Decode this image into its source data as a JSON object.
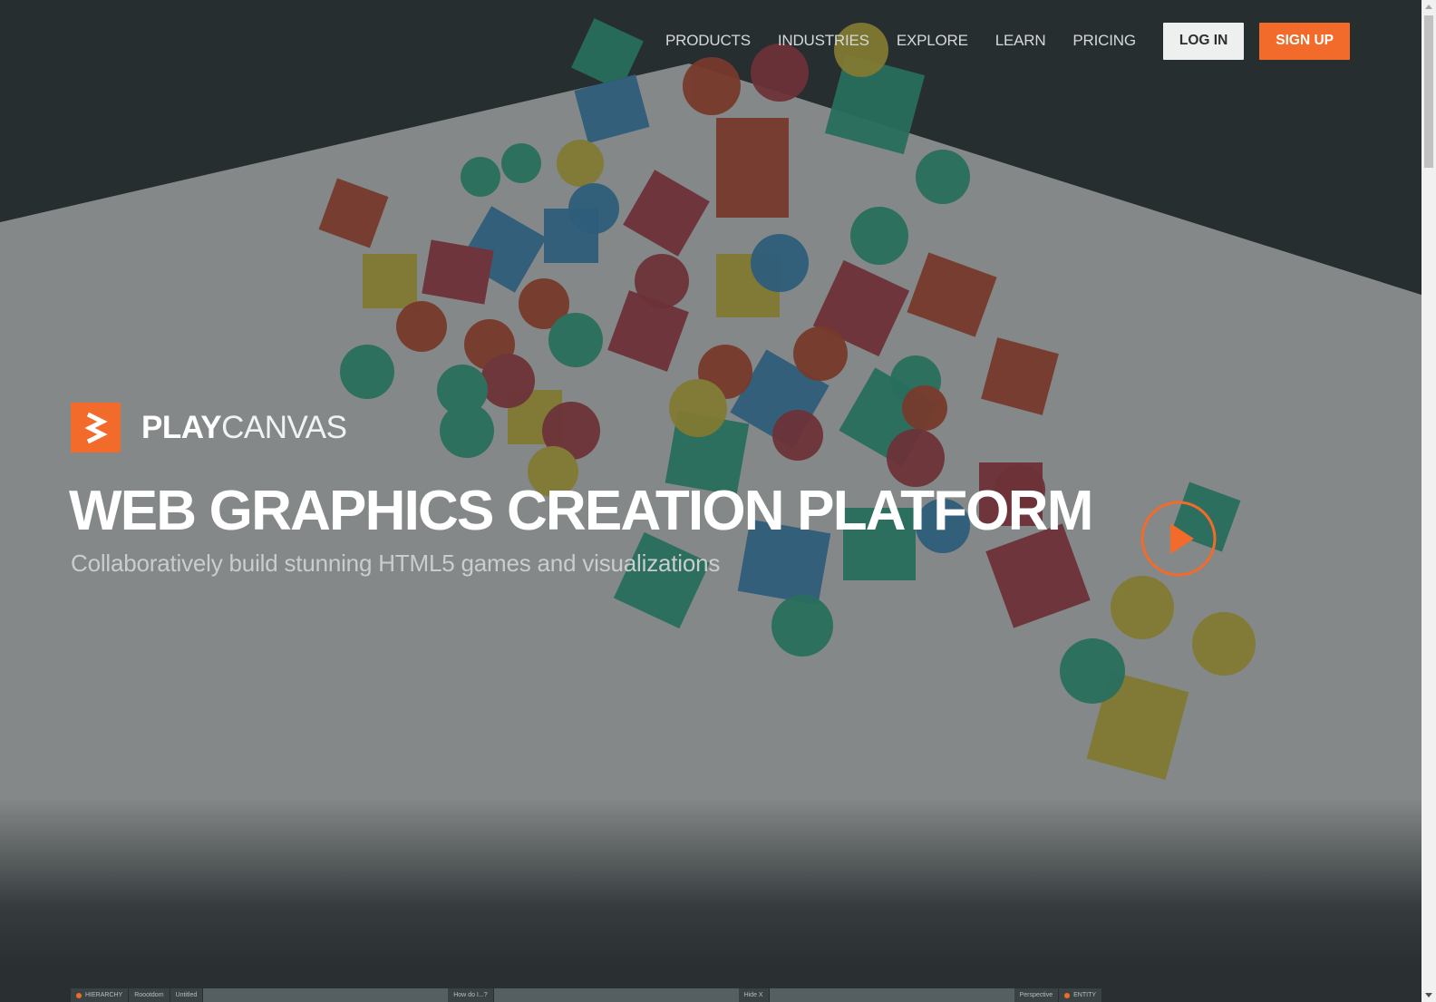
{
  "nav": {
    "items": [
      "PRODUCTS",
      "INDUSTRIES",
      "EXPLORE",
      "LEARN",
      "PRICING"
    ],
    "login_label": "LOG IN",
    "signup_label": "SIGN UP"
  },
  "brand": {
    "name_bold": "PLAY",
    "name_light": "CANVAS",
    "logo_icon": "playcanvas-logo-icon"
  },
  "hero": {
    "headline": "WEB GRAPHICS CREATION PLATFORM",
    "subheadline": "Collaboratively build stunning HTML5 games and visualizations",
    "play_icon": "play-icon"
  },
  "editor_preview": {
    "hierarchy_label": "HIERARCHY",
    "breadcrumb_root": "Roootdom",
    "breadcrumb_scene": "Untitled",
    "search_placeholder": "How do I...?",
    "hide_label": "Hide X",
    "camera_label": "Perspective",
    "entity_label": "ENTITY"
  },
  "colors": {
    "accent": "#f26b2a",
    "background": "#2a3032",
    "login_bg": "#eef0f0"
  }
}
